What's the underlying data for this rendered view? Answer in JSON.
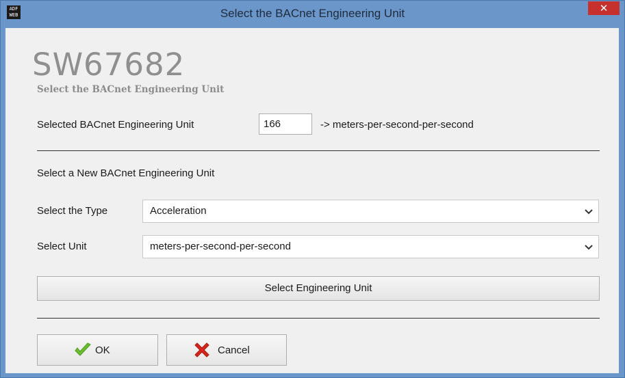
{
  "window": {
    "title": "Select the BACnet Engineering Unit",
    "close_glyph": "✕",
    "app_icon_text": [
      "ADF",
      "WEB"
    ]
  },
  "header": {
    "brand": "SW67682",
    "subtitle": "Select the BACnet Engineering Unit"
  },
  "current": {
    "label": "Selected BACnet Engineering Unit",
    "value": "166",
    "arrow_text": "-> meters-per-second-per-second"
  },
  "new_unit": {
    "heading": "Select a New BACnet Engineering Unit",
    "type_label": "Select the Type",
    "type_value": "Acceleration",
    "unit_label": "Select Unit",
    "unit_value": "meters-per-second-per-second",
    "select_button": "Select Engineering Unit"
  },
  "buttons": {
    "ok": "OK",
    "cancel": "Cancel"
  },
  "icons": {
    "app": "app-logo-icon",
    "close": "close-icon",
    "dropdown": "chevron-down-icon",
    "ok": "checkmark-icon",
    "cancel": "red-x-icon"
  },
  "colors": {
    "frame": "#6b96c9",
    "close_button": "#c7312d",
    "ok_icon": "#6abf2e",
    "cancel_icon": "#d6261f"
  }
}
